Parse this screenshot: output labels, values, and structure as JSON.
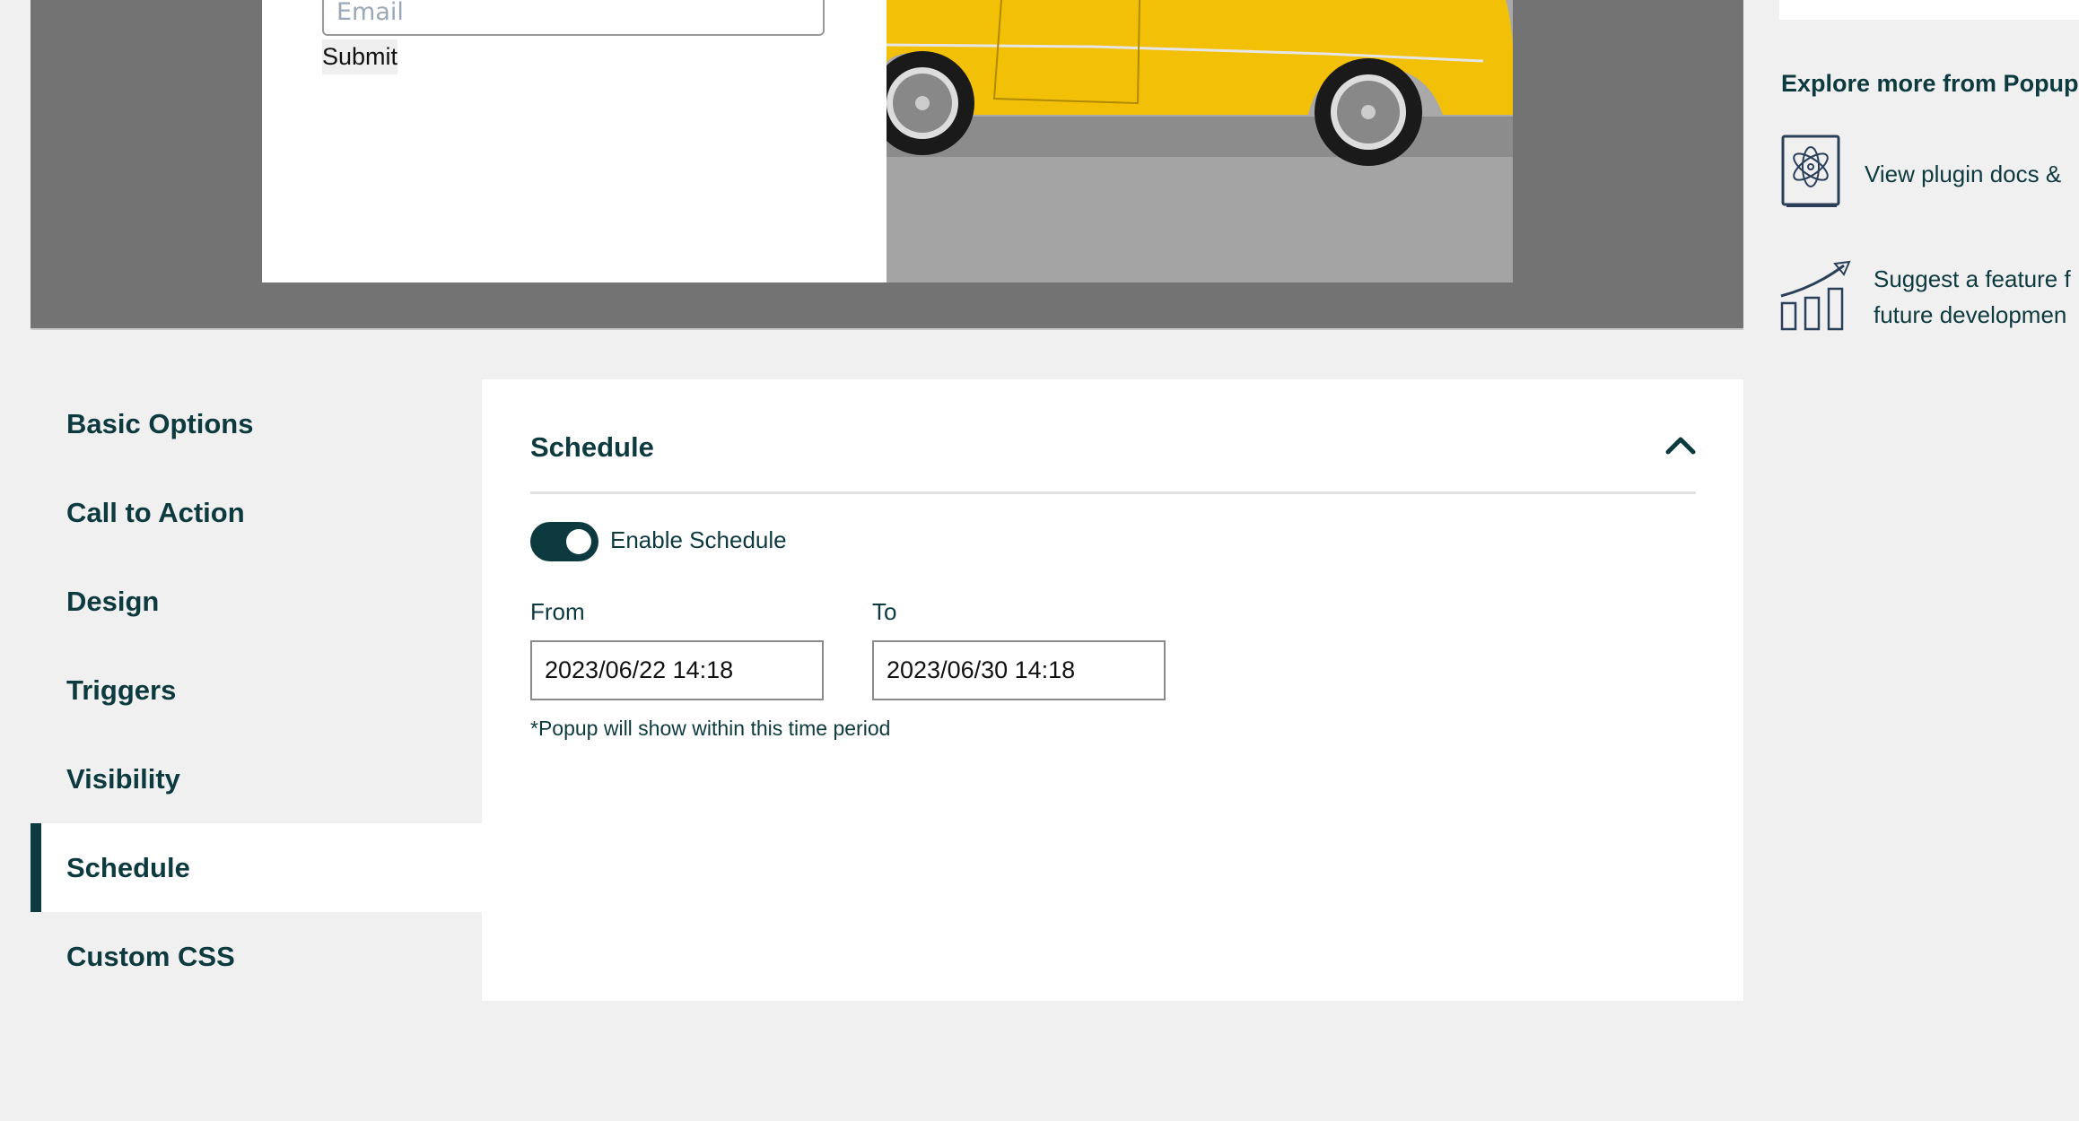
{
  "preview": {
    "email_placeholder": "Email",
    "submit_label": "Submit"
  },
  "right_sidebar": {
    "title": "Explore more from Popup",
    "links": [
      {
        "icon": "book-atom-icon",
        "label": "View plugin docs &"
      },
      {
        "icon": "growth-chart-icon",
        "label_line1": "Suggest a feature f",
        "label_line2": "future developmen"
      }
    ]
  },
  "nav": {
    "items": [
      {
        "label": "Basic Options",
        "active": false
      },
      {
        "label": "Call to Action",
        "active": false
      },
      {
        "label": "Design",
        "active": false
      },
      {
        "label": "Triggers",
        "active": false
      },
      {
        "label": "Visibility",
        "active": false
      },
      {
        "label": "Schedule",
        "active": true
      },
      {
        "label": "Custom CSS",
        "active": false
      }
    ]
  },
  "schedule": {
    "title": "Schedule",
    "collapse_icon": "chevron-up-icon",
    "enable_label": "Enable Schedule",
    "enabled": true,
    "from_label": "From",
    "from_value": "2023/06/22 14:18",
    "to_label": "To",
    "to_value": "2023/06/30 14:18",
    "note": "*Popup will show within this time period"
  },
  "colors": {
    "accent": "#0d3a3f",
    "background": "#f0f0f0",
    "preview_overlay": "#737373"
  }
}
